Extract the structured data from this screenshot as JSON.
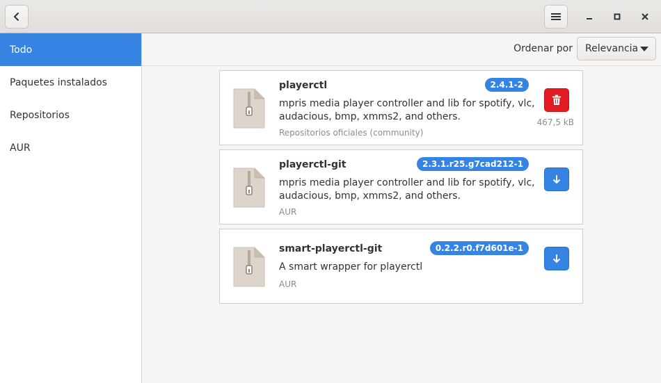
{
  "sidebar": {
    "items": [
      {
        "label": "Todo",
        "active": true
      },
      {
        "label": "Paquetes instalados",
        "active": false
      },
      {
        "label": "Repositorios",
        "active": false
      },
      {
        "label": "AUR",
        "active": false
      }
    ]
  },
  "toolbar": {
    "sort_label": "Ordenar por",
    "sort_value": "Relevancia"
  },
  "packages": [
    {
      "name": "playerctl",
      "version": "2.4.1-2",
      "description": "mpris media player controller and lib for spotify, vlc, audacious, bmp, xmms2, and others.",
      "repo": "Repositorios oficiales (community)",
      "action": "remove",
      "size": "467,5 kB"
    },
    {
      "name": "playerctl-git",
      "version": "2.3.1.r25.g7cad212-1",
      "description": "mpris media player controller and lib for spotify, vlc, audacious, bmp, xmms2, and others.",
      "repo": "AUR",
      "action": "install"
    },
    {
      "name": "smart-playerctl-git",
      "version": "0.2.2.r0.f7d601e-1",
      "description": "A smart wrapper for playerctl",
      "repo": "AUR",
      "action": "install"
    }
  ],
  "icons": {
    "back": "chevron-left-icon",
    "menu": "hamburger-menu-icon",
    "minimize": "minimize-icon",
    "maximize": "maximize-icon",
    "close": "close-icon",
    "package": "archive-file-icon",
    "remove": "trash-icon",
    "install": "download-arrow-icon"
  },
  "colors": {
    "accent": "#3584e4",
    "destructive": "#e01b24"
  }
}
